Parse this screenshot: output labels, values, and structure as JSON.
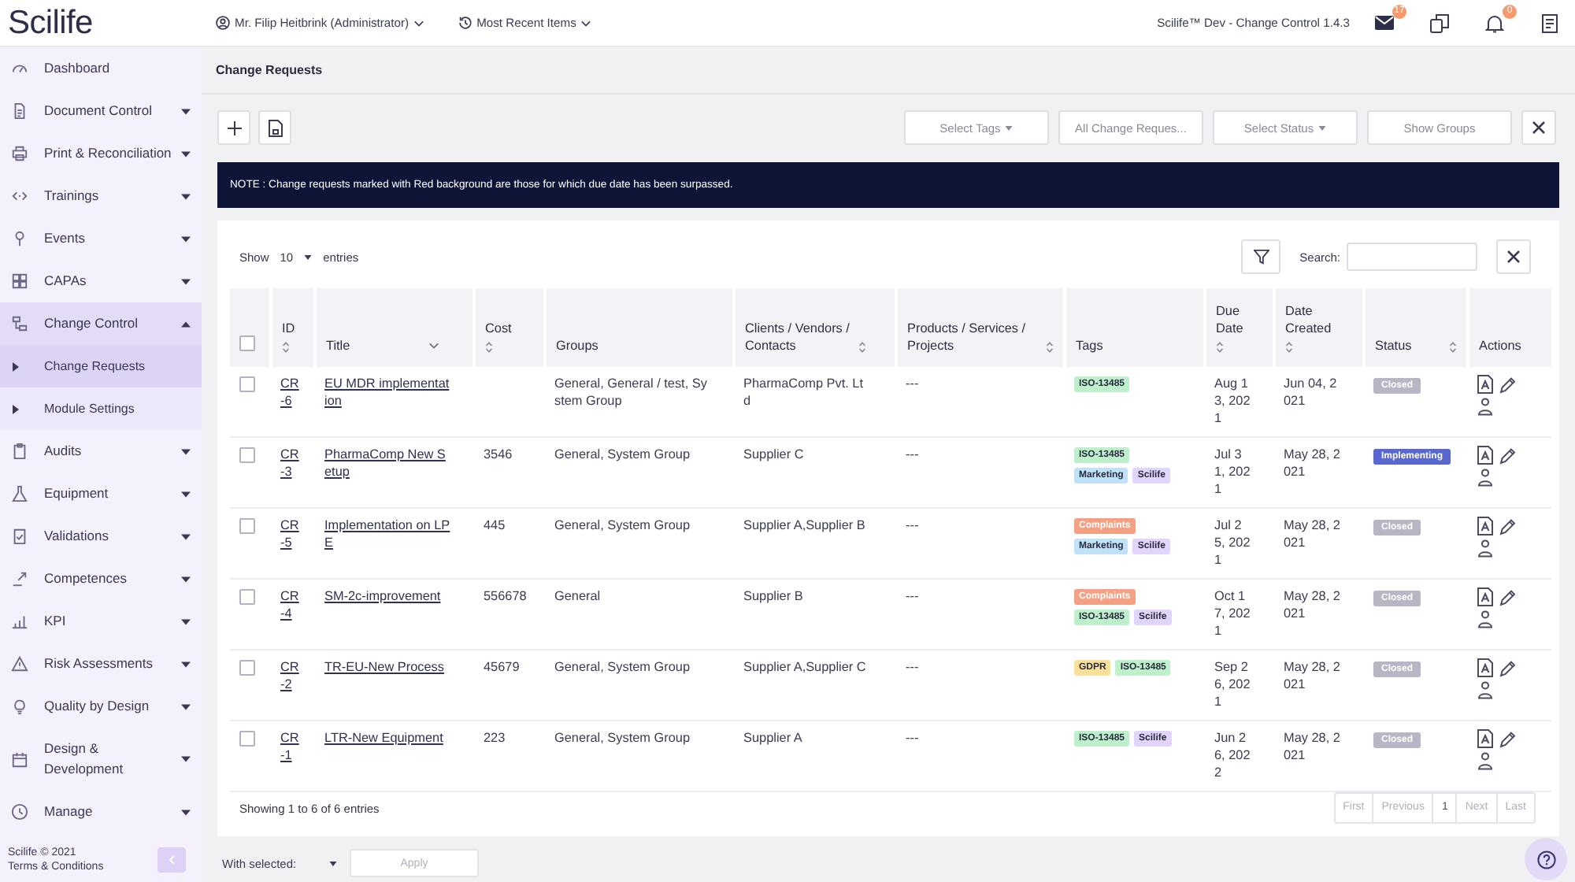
{
  "topbar": {
    "logo": "Scilife",
    "user_menu": "Mr. Filip Heitbrink (Administrator)",
    "recent_menu": "Most Recent Items",
    "environment": "Scilife™ Dev - Change Control 1.4.3",
    "mail_badge": "17",
    "bell_badge": "0"
  },
  "sidebar": {
    "items": [
      {
        "label": "Dashboard",
        "kind": "link",
        "expanded": false
      },
      {
        "label": "Document Control",
        "kind": "menu",
        "expanded": false
      },
      {
        "label": "Print & Reconciliation",
        "kind": "menu",
        "expanded": false
      },
      {
        "label": "Trainings",
        "kind": "menu",
        "expanded": false
      },
      {
        "label": "Events",
        "kind": "menu",
        "expanded": false
      },
      {
        "label": "CAPAs",
        "kind": "menu",
        "expanded": false
      },
      {
        "label": "Change Control",
        "kind": "menu",
        "expanded": true,
        "children": [
          {
            "label": "Change Requests",
            "selected": true
          },
          {
            "label": "Module Settings",
            "selected": false
          }
        ]
      },
      {
        "label": "Audits",
        "kind": "menu",
        "expanded": false
      },
      {
        "label": "Equipment",
        "kind": "menu",
        "expanded": false
      },
      {
        "label": "Validations",
        "kind": "menu",
        "expanded": false
      },
      {
        "label": "Competences",
        "kind": "menu",
        "expanded": false
      },
      {
        "label": "KPI",
        "kind": "menu",
        "expanded": false
      },
      {
        "label": "Risk Assessments",
        "kind": "menu",
        "expanded": false
      },
      {
        "label": "Quality by Design",
        "kind": "menu",
        "expanded": false
      },
      {
        "label": "Design & Development",
        "kind": "menu",
        "expanded": false
      },
      {
        "label": "Manage",
        "kind": "menu",
        "expanded": false
      }
    ],
    "copyright": "Scilife © 2021",
    "terms_link": "Terms & Conditions"
  },
  "page_title": "Change Requests",
  "toolbar": {
    "filters": [
      {
        "label": "Select Tags",
        "kind": "dropdown"
      },
      {
        "label": "All Change Reques...",
        "kind": "button"
      },
      {
        "label": "Select Status",
        "kind": "dropdown"
      },
      {
        "label": "Show Groups",
        "kind": "button"
      }
    ]
  },
  "note": "NOTE : Change requests marked with Red background are those for which due date has been surpassed.",
  "table": {
    "length_menu": {
      "prefix": "Show",
      "value": "10",
      "suffix": "entries"
    },
    "search_label": "Search:",
    "select_all": {
      "checked": false
    },
    "columns": [
      {
        "label": "ID",
        "sortable": true,
        "sorted": false
      },
      {
        "label": "Title",
        "sortable": true,
        "sorted": true
      },
      {
        "label": "Cost",
        "sortable": true,
        "sorted": false
      },
      {
        "label": "Groups",
        "sortable": false
      },
      {
        "label": "Clients / Vendors / Contacts",
        "sortable": true,
        "sorted": false
      },
      {
        "label": "Products / Services / Projects",
        "sortable": true,
        "sorted": false
      },
      {
        "label": "Tags",
        "sortable": false
      },
      {
        "label": "Due Date",
        "sortable": true,
        "sorted": false
      },
      {
        "label": "Date Created",
        "sortable": true,
        "sorted": false
      },
      {
        "label": "Status",
        "sortable": true,
        "sorted": false
      },
      {
        "label": "Actions",
        "sortable": false
      }
    ],
    "rows": [
      {
        "checked": false,
        "id": "CR-6",
        "title": "EU MDR implementation",
        "groups": "General, General / test, System Group",
        "clients": "PharmaComp Pvt. Ltd",
        "products": "---",
        "tags": [
          {
            "label": "ISO-13485",
            "color": "#bdf0cb"
          }
        ],
        "due_date": "Aug 13, 2021",
        "created": "Jun 04, 2021",
        "status": {
          "label": "Closed",
          "color": "#b6b6c4"
        }
      },
      {
        "checked": false,
        "id": "CR-3",
        "title": "PharmaComp New Setup",
        "cost": "3546",
        "groups": "General, System Group",
        "clients": "Supplier C",
        "products": "---",
        "tags": [
          {
            "label": "ISO-13485",
            "color": "#bdf0cb"
          },
          {
            "label": "Marketing",
            "color": "#bfe2f8"
          },
          {
            "label": "Scilife",
            "color": "#e2d5fb"
          }
        ],
        "due_date": "Jul 31, 2021",
        "created": "May 28, 2021",
        "status": {
          "label": "Implementing",
          "color": "#5868cf"
        }
      },
      {
        "checked": false,
        "id": "CR-5",
        "title": "Implementation on LPE",
        "cost": "445",
        "groups": "General, System Group",
        "clients": "Supplier A,Supplier B",
        "products": "---",
        "tags": [
          {
            "label": "Complaints",
            "color": "#f4a183"
          },
          {
            "label": "Marketing",
            "color": "#bfe2f8"
          },
          {
            "label": "Scilife",
            "color": "#e2d5fb"
          }
        ],
        "due_date": "Jul 25, 2021",
        "created": "May 28, 2021",
        "status": {
          "label": "Closed",
          "color": "#b6b6c4"
        }
      },
      {
        "checked": false,
        "id": "CR-4",
        "title": "SM-2c-improvement",
        "cost": "556678",
        "groups": "General",
        "clients": "Supplier B",
        "products": "---",
        "tags": [
          {
            "label": "Complaints",
            "color": "#f4a183"
          },
          {
            "label": "ISO-13485",
            "color": "#bdf0cb"
          },
          {
            "label": "Scilife",
            "color": "#e2d5fb"
          }
        ],
        "due_date": "Oct 17, 2021",
        "created": "May 28, 2021",
        "status": {
          "label": "Closed",
          "color": "#b6b6c4"
        }
      },
      {
        "checked": false,
        "id": "CR-2",
        "title": "TR-EU-New Process",
        "cost": "45679",
        "groups": "General, System Group",
        "clients": "Supplier A,Supplier C",
        "products": "---",
        "tags": [
          {
            "label": "GDPR",
            "color": "#fbe09a"
          },
          {
            "label": "ISO-13485",
            "color": "#bdf0cb"
          }
        ],
        "due_date": "Sep 26, 2021",
        "created": "May 28, 2021",
        "status": {
          "label": "Closed",
          "color": "#b6b6c4"
        }
      },
      {
        "checked": false,
        "id": "CR-1",
        "title": "LTR-New Equipment",
        "cost": "223",
        "groups": "General, System Group",
        "clients": "Supplier A",
        "products": "---",
        "tags": [
          {
            "label": "ISO-13485",
            "color": "#bdf0cb"
          },
          {
            "label": "Scilife",
            "color": "#e2d5fb"
          }
        ],
        "due_date": "Jun 26, 2022",
        "created": "May 28, 2021",
        "status": {
          "label": "Closed",
          "color": "#b6b6c4"
        }
      }
    ],
    "info": "Showing 1 to 6 of 6 entries",
    "pagination": [
      {
        "label": "First",
        "disabled": true
      },
      {
        "label": "Previous",
        "disabled": true
      },
      {
        "label": "1",
        "disabled": false
      },
      {
        "label": "Next",
        "disabled": true
      },
      {
        "label": "Last",
        "disabled": true
      }
    ]
  },
  "bulk_actions": {
    "select_label": "With selected:",
    "apply": {
      "label": "Apply",
      "disabled": true
    }
  }
}
